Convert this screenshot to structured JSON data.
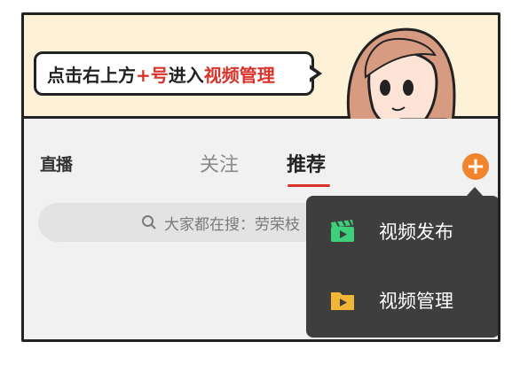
{
  "tip": {
    "part1": "点击右上方",
    "part2": "+号",
    "part3": "进入",
    "part4": "视频管理"
  },
  "header": {
    "live_icon": "live-tv-icon",
    "live_label": "直播",
    "tabs": [
      {
        "label": "关注",
        "active": false
      },
      {
        "label": "推荐",
        "active": true
      }
    ],
    "add_icon": "plus-icon"
  },
  "search": {
    "icon": "search-icon",
    "placeholder": "大家都在搜：劳荣枝"
  },
  "menu": {
    "items": [
      {
        "label": "视频发布",
        "icon": "clapperboard-icon",
        "color": "#3ecf7a"
      },
      {
        "label": "视频管理",
        "icon": "folder-play-icon",
        "color": "#f2b637"
      }
    ]
  },
  "colors": {
    "accent": "#d8332b",
    "plus": "#f0852d",
    "menu_bg": "#3e3e3e",
    "banner_bg": "#fdf1d7"
  }
}
